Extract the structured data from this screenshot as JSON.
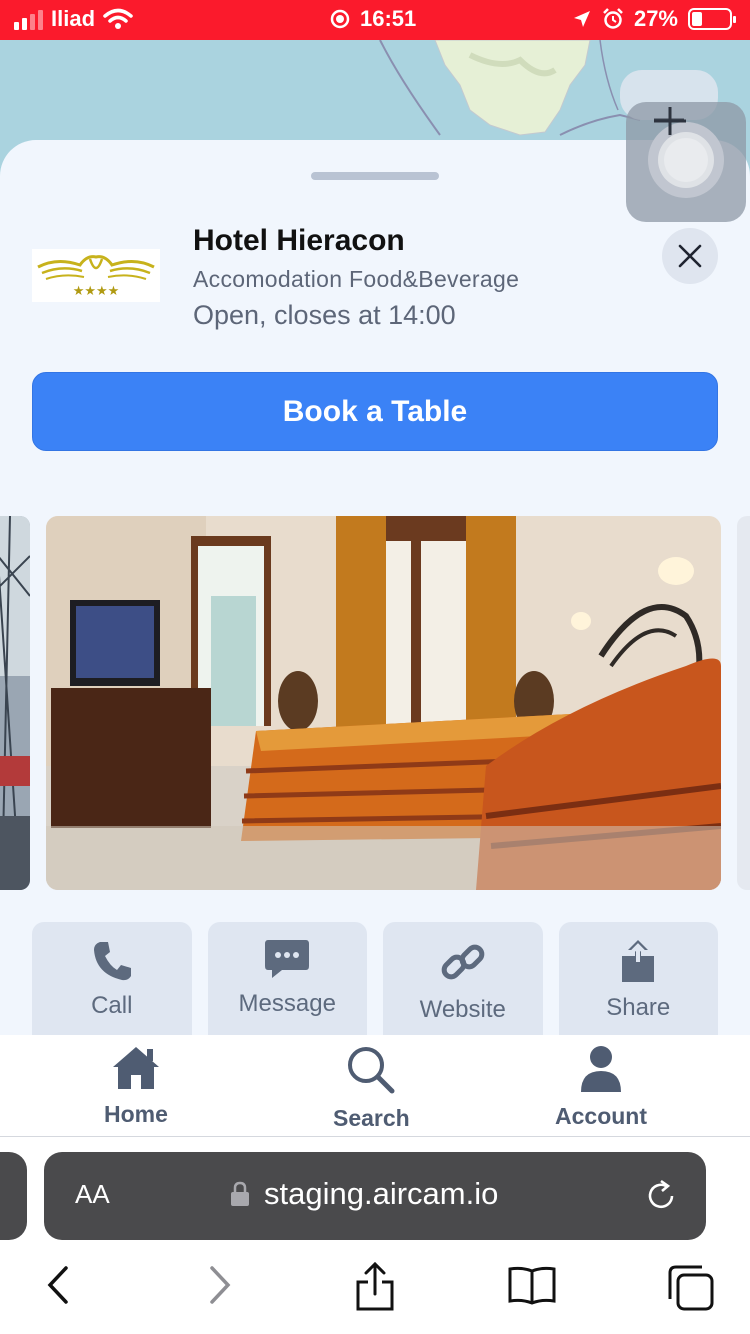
{
  "status_bar": {
    "carrier": "Iliad",
    "time": "16:51",
    "battery": "27%",
    "battery_level": 0.27
  },
  "sheet": {
    "title": "Hotel Hieracon",
    "subtitle": "Accomodation Food&Beverage",
    "hours": "Open, closes at 14:00",
    "book_button": "Book a Table",
    "actions": [
      {
        "label": "Call",
        "icon": "phone-icon"
      },
      {
        "label": "Message",
        "icon": "message-icon"
      },
      {
        "label": "Website",
        "icon": "link-icon"
      },
      {
        "label": "Share",
        "icon": "share-icon"
      }
    ]
  },
  "tab_bar": {
    "items": [
      {
        "label": "Home",
        "icon": "home-icon"
      },
      {
        "label": "Search",
        "icon": "search-icon"
      },
      {
        "label": "Account",
        "icon": "account-icon"
      }
    ]
  },
  "browser": {
    "aa": "AA",
    "url": "staging.aircam.io"
  },
  "colors": {
    "status_bar": "#fb1a2c",
    "accent": "#3b82f6",
    "sheet_bg": "#f1f6fd",
    "action_bg": "#dfe6f1",
    "muted_text": "#5d6678"
  }
}
